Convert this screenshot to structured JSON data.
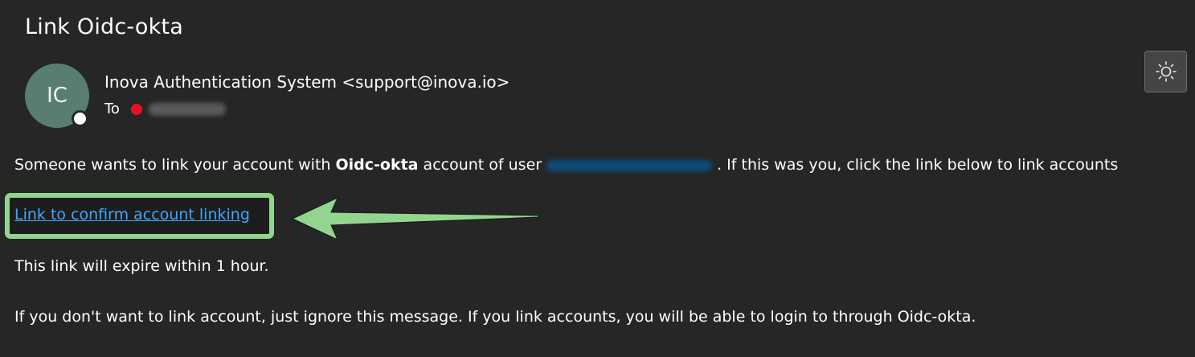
{
  "email": {
    "subject": "Link Oidc-okta",
    "avatar_initials": "IC",
    "sender": "Inova Authentication System <support@inova.io>",
    "to_label": "To",
    "body": {
      "line1_before": "Someone wants to link your account with ",
      "line1_bold": "Oidc-okta",
      "line1_middle": " account of user",
      "line1_after": ". If this was you, click the link below to link accounts",
      "link_text": "Link to confirm account linking",
      "expiry_text": "This link will expire within 1 hour.",
      "ignore_text": "If you don't want to link account, just ignore this message. If you link accounts, you will be able to login to through Oidc-okta."
    }
  },
  "icons": {
    "theme_toggle": "sun-icon",
    "presence": "presence-status-icon",
    "annotation_arrow": "arrow-left-icon"
  },
  "colors": {
    "background": "#262626",
    "avatar": "#587e73",
    "link": "#3ea6ff",
    "highlight": "#93d48e",
    "recipient_status": "#e81123"
  }
}
